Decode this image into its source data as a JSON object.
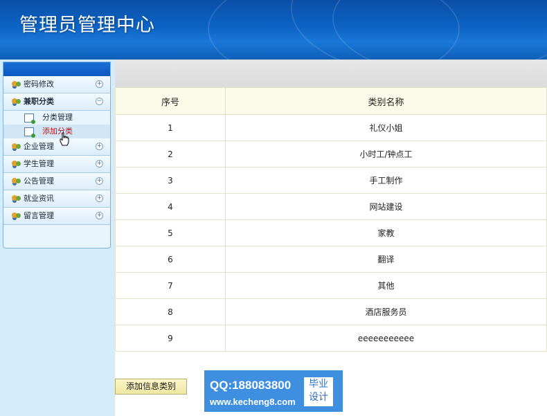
{
  "header": {
    "title": "管理员管理中心"
  },
  "sidebar": {
    "items": [
      {
        "label": "密码修改",
        "toggle": "+"
      },
      {
        "label": "兼职分类",
        "toggle": "−",
        "sub": [
          {
            "label": "分类管理"
          },
          {
            "label": "添加分类"
          }
        ]
      },
      {
        "label": "企业管理",
        "toggle": "+"
      },
      {
        "label": "学生管理",
        "toggle": "+"
      },
      {
        "label": "公告管理",
        "toggle": "+"
      },
      {
        "label": "就业资讯",
        "toggle": "+"
      },
      {
        "label": "留言管理",
        "toggle": "+"
      }
    ]
  },
  "table": {
    "headers": [
      "序号",
      "类别名称"
    ],
    "rows": [
      [
        "1",
        "礼仪小姐"
      ],
      [
        "2",
        "小时工/钟点工"
      ],
      [
        "3",
        "手工制作"
      ],
      [
        "4",
        "网站建设"
      ],
      [
        "5",
        "家教"
      ],
      [
        "6",
        "翻译"
      ],
      [
        "7",
        "其他"
      ],
      [
        "8",
        "酒店服务员"
      ],
      [
        "9",
        "eeeeeeeeeee"
      ]
    ]
  },
  "actions": {
    "add_label": "添加信息类别"
  },
  "watermark": {
    "qq": "QQ:188083800",
    "url": "www.kecheng8.com",
    "badge_line1": "毕业",
    "badge_line2": "设计"
  }
}
